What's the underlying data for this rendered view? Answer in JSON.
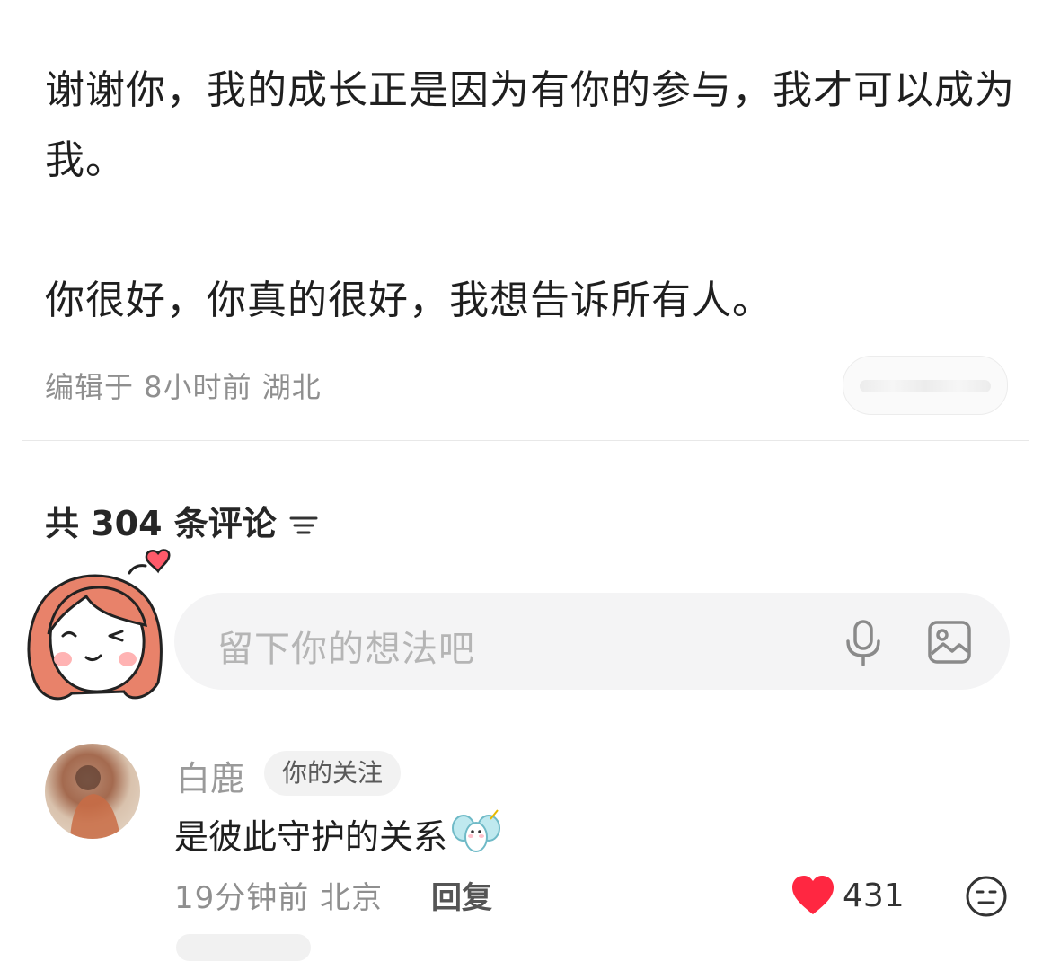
{
  "post": {
    "paragraphs": [
      "谢谢你，我的成长正是因为有你的参与，我才可以成为我。",
      "你很好，你真的很好，我想告诉所有人。"
    ],
    "meta": "编辑于 8小时前 湖北"
  },
  "comments_section": {
    "header": "共 304 条评论",
    "input_placeholder": "留下你的想法吧"
  },
  "comments": [
    {
      "author": "白鹿",
      "badge": "你的关注",
      "text": "是彼此守护的关系",
      "meta": "19分钟前 北京",
      "reply_label": "回复",
      "likes": "431"
    }
  ],
  "colors": {
    "like_heart": "#ff2741",
    "avatar_hair": "#e8826a"
  }
}
